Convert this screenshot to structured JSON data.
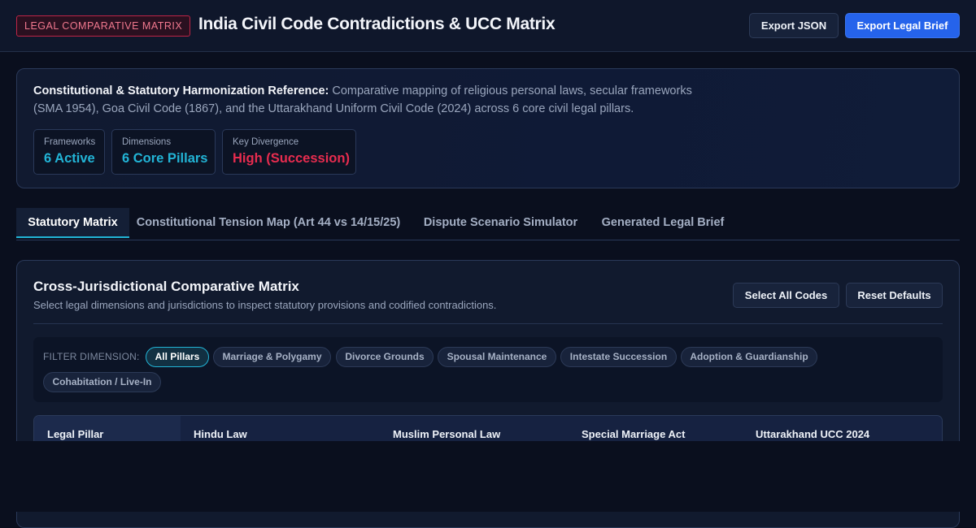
{
  "header": {
    "badge": "LEGAL COMPARATIVE MATRIX",
    "title": "India Civil Code Contradictions & UCC Matrix",
    "export_json_label": "Export JSON",
    "export_brief_label": "Export Legal Brief"
  },
  "info": {
    "lead": "Constitutional & Statutory Harmonization Reference:",
    "body": " Comparative mapping of religious personal laws, secular frameworks (SMA 1954), Goa Civil Code (1867), and the Uttarakhand Uniform Civil Code (2024) across 6 core civil legal pillars.",
    "stats": [
      {
        "label": "Frameworks",
        "value": "6 Active"
      },
      {
        "label": "Dimensions",
        "value": "6 Core Pillars"
      },
      {
        "label": "Key Divergence",
        "value": "High (Succession)"
      }
    ]
  },
  "tabs": [
    {
      "label": "Statutory Matrix",
      "active": true
    },
    {
      "label": "Constitutional Tension Map (Art 44 vs 14/15/25)",
      "active": false
    },
    {
      "label": "Dispute Scenario Simulator",
      "active": false
    },
    {
      "label": "Generated Legal Brief",
      "active": false
    }
  ],
  "panel": {
    "title": "Cross-Jurisdictional Comparative Matrix",
    "subtitle": "Select legal dimensions and jurisdictions to inspect statutory provisions and codified contradictions.",
    "select_all_label": "Select All Codes",
    "reset_label": "Reset Defaults",
    "filter_label": "FILTER DIMENSION:",
    "filters": [
      {
        "label": "All Pillars",
        "active": true
      },
      {
        "label": "Marriage & Polygamy",
        "active": false
      },
      {
        "label": "Divorce Grounds",
        "active": false
      },
      {
        "label": "Spousal Maintenance",
        "active": false
      },
      {
        "label": "Intestate Succession",
        "active": false
      },
      {
        "label": "Adoption & Guardianship",
        "active": false
      },
      {
        "label": "Cohabitation / Live-In",
        "active": false
      }
    ],
    "table_headers": [
      "Legal Pillar",
      "Hindu Law",
      "Muslim Personal Law",
      "Special Marriage Act",
      "Uttarakhand UCC 2024"
    ]
  },
  "colors": {
    "accent": "#22b4d6",
    "primary": "#2563eb",
    "danger": "#e82c4f",
    "background": "#0a0f1e"
  }
}
